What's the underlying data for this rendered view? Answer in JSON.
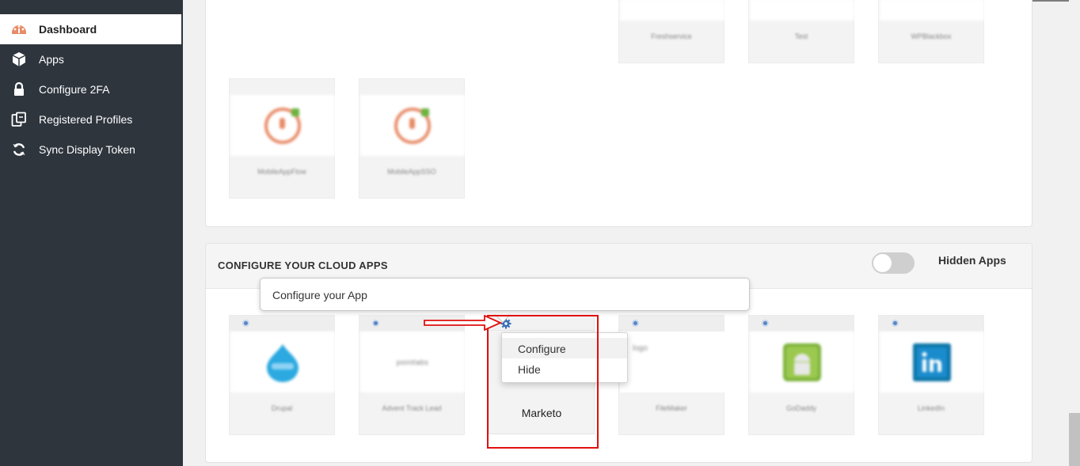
{
  "sidebar": {
    "items": [
      {
        "label": "Dashboard",
        "icon": "dashboard-gauge-icon",
        "active": true
      },
      {
        "label": "Apps",
        "icon": "cube-icon"
      },
      {
        "label": "Configure 2FA",
        "icon": "lock-icon"
      },
      {
        "label": "Registered Profiles",
        "icon": "clipboard-icon"
      },
      {
        "label": "Sync Display Token",
        "icon": "refresh-icon"
      }
    ]
  },
  "top_panel": {
    "apps": [
      {
        "name": "Freshservice"
      },
      {
        "name": "Test"
      },
      {
        "name": "WPBlackbox"
      },
      {
        "name": "MobileAppFlow"
      },
      {
        "name": "MobileAppSSO"
      }
    ]
  },
  "cloud_apps": {
    "title": "CONFIGURE YOUR CLOUD APPS",
    "hidden_apps_label": "Hidden Apps",
    "hidden_apps_enabled": false,
    "tooltip": "Configure your App",
    "apps": [
      {
        "name": "Drupal",
        "logo": "drupal-logo-icon"
      },
      {
        "name": "Advent Track Lead",
        "logo": "pointlabs-logo-icon"
      },
      {
        "name": "Marketo",
        "logo": "gear-icon"
      },
      {
        "name": "FileMaker",
        "logo": "broken-image-icon",
        "logo_alt": "logo"
      },
      {
        "name": "GoDaddy",
        "logo": "android-logo-icon"
      },
      {
        "name": "LinkedIn",
        "logo": "linkedin-logo-icon"
      }
    ],
    "menu": {
      "configure": "Configure",
      "hide": "Hide"
    }
  },
  "colors": {
    "sidebar_bg": "#2e353d",
    "accent_orange": "#e88b67",
    "highlight_red": "#e10f0f",
    "linkedin_blue": "#0e76a8"
  }
}
